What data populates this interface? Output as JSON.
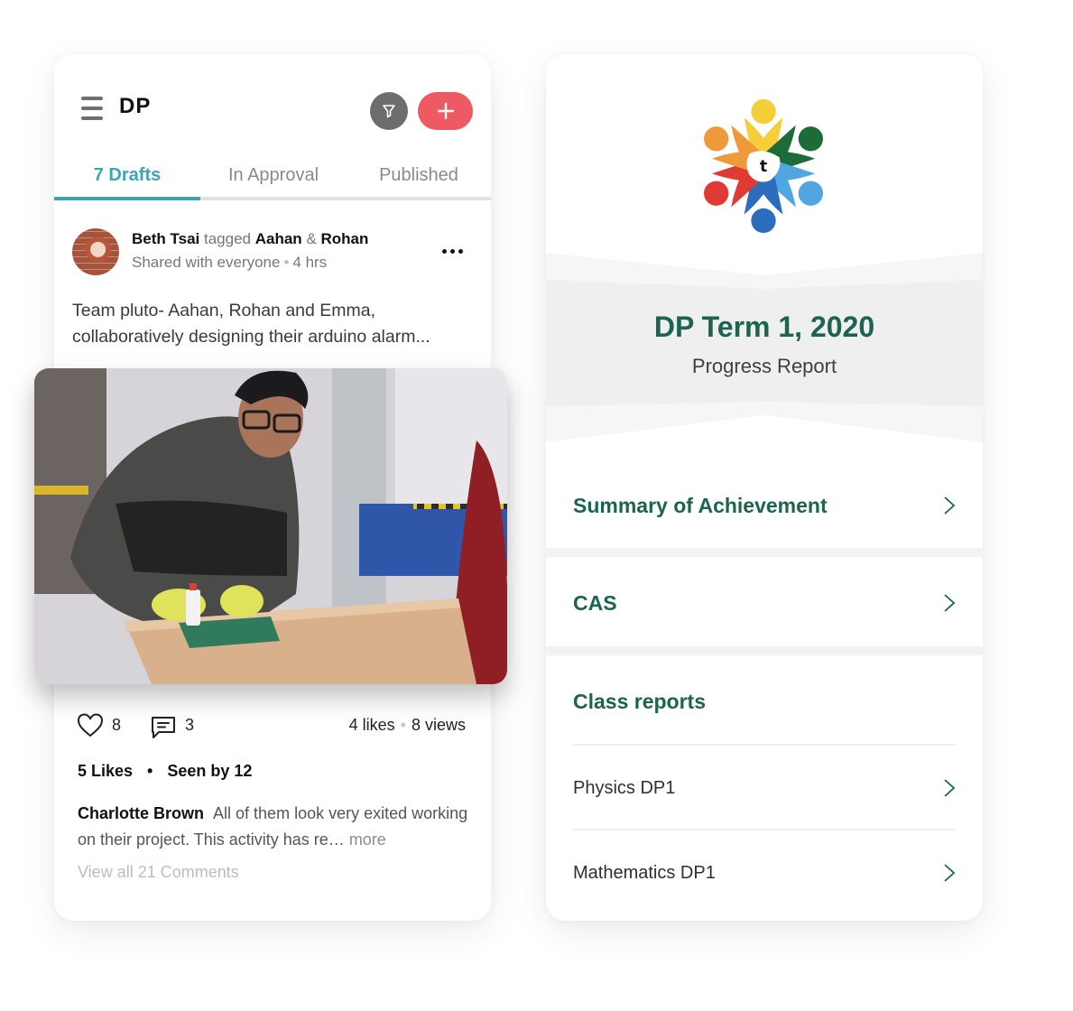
{
  "feed": {
    "title": "DP",
    "icons": {
      "menu": "hamburger-icon",
      "filter": "filter-funnel-icon",
      "add": "plus-icon"
    },
    "colors": {
      "accent": "#3fa3b4",
      "add_button": "#ee5a63",
      "filter_button": "#6d6d6d"
    },
    "tabs": [
      {
        "label": "7 Drafts",
        "active": true
      },
      {
        "label": "In Approval",
        "active": false
      },
      {
        "label": "Published",
        "active": false
      }
    ],
    "post": {
      "author": "Beth Tsai",
      "tagged_word": "tagged",
      "tag_1": "Aahan",
      "amp": "&",
      "tag_2": "Rohan",
      "visibility": "Shared with everyone",
      "separator": "•",
      "time": "4 hrs",
      "text": "Team pluto- Aahan, Rohan and Emma, collaboratively designing their arduino alarm...",
      "image_alt": "Student in glasses and yellow gloves assembling a project at a workshop table",
      "like_count": "8",
      "comment_count": "3",
      "likes_text": "4 likes",
      "views_text": "8 views",
      "likes_summary": "5 Likes",
      "seen_by": "Seen by 12",
      "top_comment": {
        "author": "Charlotte Brown",
        "text": "All of them look very exited working on their project. This activity has re…",
        "more": "more"
      },
      "view_all": "View all 21 Comments"
    }
  },
  "report": {
    "logo_letter": "t",
    "title": "DP Term 1, 2020",
    "subtitle": "Progress Report",
    "colors": {
      "accent": "#1c6350"
    },
    "sections": [
      {
        "label": "Summary of Achievement"
      },
      {
        "label": "CAS"
      }
    ],
    "class_reports": {
      "label": "Class reports",
      "items": [
        {
          "label": "Physics DP1"
        },
        {
          "label": "Mathematics DP1"
        }
      ]
    }
  }
}
